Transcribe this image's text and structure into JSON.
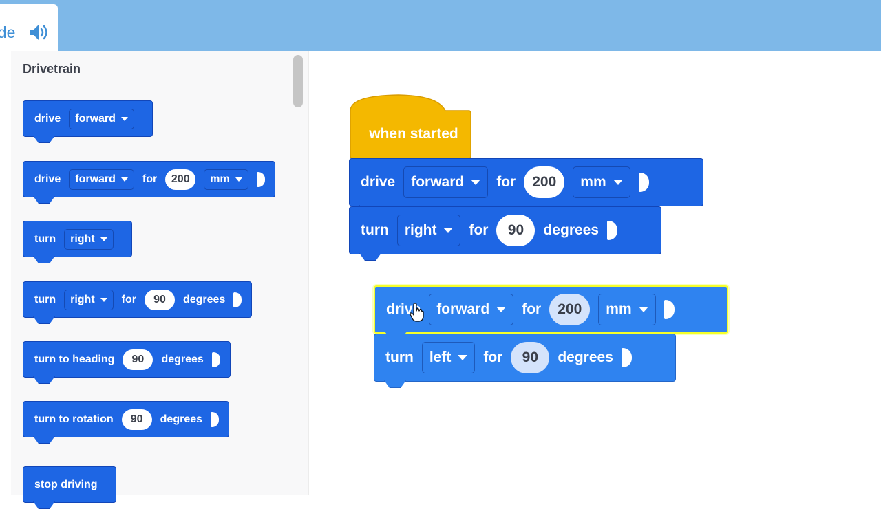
{
  "tab": {
    "label": "ode",
    "icon": "speaker-icon"
  },
  "palette": {
    "title": "Drivetrain",
    "blocks": [
      {
        "t1": "drive",
        "dd1": "forward"
      },
      {
        "t1": "drive",
        "dd1": "forward",
        "t2": "for",
        "num": "200",
        "dd2": "mm"
      },
      {
        "t1": "turn",
        "dd1": "right"
      },
      {
        "t1": "turn",
        "dd1": "right",
        "t2": "for",
        "num": "90",
        "t3": "degrees"
      },
      {
        "t1": "turn to heading",
        "num": "90",
        "t3": "degrees"
      },
      {
        "t1": "turn to rotation",
        "num": "90",
        "t3": "degrees"
      },
      {
        "t1": "stop driving"
      }
    ]
  },
  "workspace": {
    "hat": {
      "label": "when started",
      "color": "#f4b800"
    },
    "script": [
      {
        "t1": "drive",
        "dd1": "forward",
        "t2": "for",
        "num": "200",
        "dd2": "mm"
      },
      {
        "t1": "turn",
        "dd1": "right",
        "t2": "for",
        "num": "90",
        "t3": "degrees"
      }
    ],
    "dragging": [
      {
        "t1": "drive",
        "dd1": "forward",
        "t2": "for",
        "num": "200",
        "dd2": "mm"
      },
      {
        "t1": "turn",
        "dd1": "left",
        "t2": "for",
        "num": "90",
        "t3": "degrees"
      }
    ]
  },
  "colors": {
    "block": "#1e66e4",
    "hat": "#f4b800",
    "topbar": "#7eb8e8",
    "highlight": "#f5ff2a"
  }
}
